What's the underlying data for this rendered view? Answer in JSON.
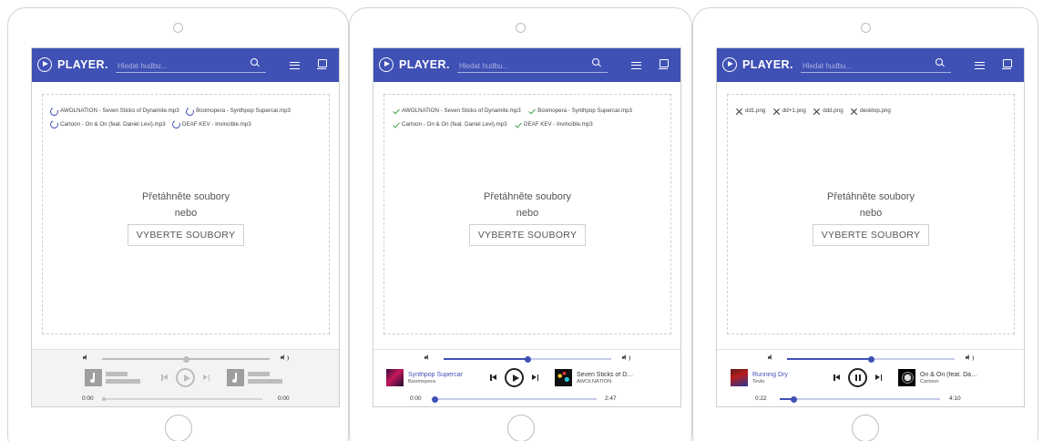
{
  "app": {
    "brand": "PLAYER.",
    "search_placeholder": "Hledat hudbu...",
    "accent_color": "#3f51b5"
  },
  "devices": [
    {
      "state": "uploading",
      "files": [
        {
          "name": "AWOLNATION - Seven Sticks of Dynamite.mp3",
          "status": "loading",
          "icon": "spinner-icon"
        },
        {
          "name": "Boomopera - Synthpop Supercar.mp3",
          "status": "loading",
          "icon": "spinner-icon"
        },
        {
          "name": "Cartoon - On & On (feat. Daniel Levi).mp3",
          "status": "loading",
          "icon": "spinner-icon"
        },
        {
          "name": "DEAF KEV - Invincible.mp3",
          "status": "loading",
          "icon": "spinner-icon"
        }
      ],
      "drop_text": "Přetáhněte soubory",
      "or_text": "nebo",
      "select_label": "VYBERTE SOUBORY",
      "player": {
        "disabled": true,
        "volume": 0.5,
        "progress": 0.0,
        "playing": false,
        "time_current": "0:00",
        "time_total": "0:00"
      }
    },
    {
      "state": "uploaded",
      "files": [
        {
          "name": "AWOLNATION - Seven Sticks of Dynamite.mp3",
          "status": "done",
          "icon": "check-icon"
        },
        {
          "name": "Boomopera - Synthpop Supercar.mp3",
          "status": "done",
          "icon": "check-icon"
        },
        {
          "name": "Cartoon - On & On (feat. Daniel Levi).mp3",
          "status": "done",
          "icon": "check-icon"
        },
        {
          "name": "DEAF KEV - Invincible.mp3",
          "status": "done",
          "icon": "check-icon"
        }
      ],
      "drop_text": "Přetáhněte soubory",
      "or_text": "nebo",
      "select_label": "VYBERTE SOUBORY",
      "player": {
        "disabled": false,
        "volume": 0.5,
        "progress": 0.0,
        "playing": false,
        "time_current": "0:00",
        "time_total": "2:47",
        "prev_track": {
          "title": "Synthpop Supercar",
          "artist": "Boomopera"
        },
        "next_track": {
          "title": "Seven Sticks of Dy...",
          "artist": "AWOLNATION"
        }
      }
    },
    {
      "state": "rejected",
      "files": [
        {
          "name": "dd1.png",
          "status": "error",
          "icon": "x-icon"
        },
        {
          "name": "dd+1.png",
          "status": "error",
          "icon": "x-icon"
        },
        {
          "name": "ddd.png",
          "status": "error",
          "icon": "x-icon"
        },
        {
          "name": "desktop.png",
          "status": "error",
          "icon": "x-icon"
        }
      ],
      "drop_text": "Přetáhněte soubory",
      "or_text": "nebo",
      "select_label": "VYBERTE SOUBORY",
      "player": {
        "disabled": false,
        "volume": 0.5,
        "progress": 0.09,
        "playing": true,
        "time_current": "0:22",
        "time_total": "4:10",
        "prev_track": {
          "title": "Running Dry",
          "artist": "Tevlo"
        },
        "next_track": {
          "title": "On & On (feat. Dani...",
          "artist": "Cartoon"
        }
      }
    }
  ]
}
